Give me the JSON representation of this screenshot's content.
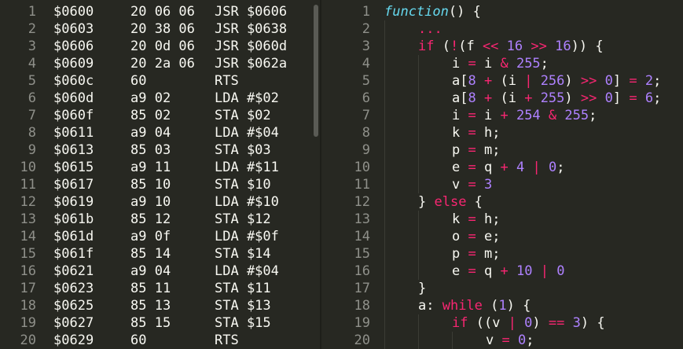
{
  "left_pane": {
    "lines": [
      {
        "n": "1",
        "addr": "$0600",
        "hex": "20 06 06",
        "ins": "JSR $0606"
      },
      {
        "n": "2",
        "addr": "$0603",
        "hex": "20 38 06",
        "ins": "JSR $0638"
      },
      {
        "n": "3",
        "addr": "$0606",
        "hex": "20 0d 06",
        "ins": "JSR $060d"
      },
      {
        "n": "4",
        "addr": "$0609",
        "hex": "20 2a 06",
        "ins": "JSR $062a"
      },
      {
        "n": "5",
        "addr": "$060c",
        "hex": "60",
        "ins": "RTS"
      },
      {
        "n": "6",
        "addr": "$060d",
        "hex": "a9 02",
        "ins": "LDA #$02"
      },
      {
        "n": "7",
        "addr": "$060f",
        "hex": "85 02",
        "ins": "STA $02"
      },
      {
        "n": "8",
        "addr": "$0611",
        "hex": "a9 04",
        "ins": "LDA #$04"
      },
      {
        "n": "9",
        "addr": "$0613",
        "hex": "85 03",
        "ins": "STA $03"
      },
      {
        "n": "10",
        "addr": "$0615",
        "hex": "a9 11",
        "ins": "LDA #$11"
      },
      {
        "n": "11",
        "addr": "$0617",
        "hex": "85 10",
        "ins": "STA $10"
      },
      {
        "n": "12",
        "addr": "$0619",
        "hex": "a9 10",
        "ins": "LDA #$10"
      },
      {
        "n": "13",
        "addr": "$061b",
        "hex": "85 12",
        "ins": "STA $12"
      },
      {
        "n": "14",
        "addr": "$061d",
        "hex": "a9 0f",
        "ins": "LDA #$0f"
      },
      {
        "n": "15",
        "addr": "$061f",
        "hex": "85 14",
        "ins": "STA $14"
      },
      {
        "n": "16",
        "addr": "$0621",
        "hex": "a9 04",
        "ins": "LDA #$04"
      },
      {
        "n": "17",
        "addr": "$0623",
        "hex": "85 11",
        "ins": "STA $11"
      },
      {
        "n": "18",
        "addr": "$0625",
        "hex": "85 13",
        "ins": "STA $13"
      },
      {
        "n": "19",
        "addr": "$0627",
        "hex": "85 15",
        "ins": "STA $15"
      },
      {
        "n": "20",
        "addr": "$0629",
        "hex": "60",
        "ins": "RTS"
      }
    ]
  },
  "right_pane": {
    "lines": [
      {
        "n": "1",
        "indent": 0,
        "tokens": [
          [
            "fn",
            "function"
          ],
          [
            "pl",
            "() {"
          ]
        ]
      },
      {
        "n": "2",
        "indent": 1,
        "tokens": [
          [
            "kw",
            "..."
          ]
        ]
      },
      {
        "n": "3",
        "indent": 1,
        "tokens": [
          [
            "kw",
            "if"
          ],
          [
            "pl",
            " ("
          ],
          [
            "op",
            "!"
          ],
          [
            "pl",
            "(f "
          ],
          [
            "op",
            "<<"
          ],
          [
            "pl",
            " "
          ],
          [
            "num",
            "16"
          ],
          [
            "pl",
            " "
          ],
          [
            "op",
            ">>"
          ],
          [
            "pl",
            " "
          ],
          [
            "num",
            "16"
          ],
          [
            "pl",
            ")) {"
          ]
        ]
      },
      {
        "n": "4",
        "indent": 2,
        "tokens": [
          [
            "pl",
            "i "
          ],
          [
            "op",
            "="
          ],
          [
            "pl",
            " i "
          ],
          [
            "op",
            "&"
          ],
          [
            "pl",
            " "
          ],
          [
            "num",
            "255"
          ],
          [
            "pl",
            ";"
          ]
        ]
      },
      {
        "n": "5",
        "indent": 2,
        "tokens": [
          [
            "pl",
            "a["
          ],
          [
            "num",
            "8"
          ],
          [
            "pl",
            " "
          ],
          [
            "op",
            "+"
          ],
          [
            "pl",
            " (i "
          ],
          [
            "op",
            "|"
          ],
          [
            "pl",
            " "
          ],
          [
            "num",
            "256"
          ],
          [
            "pl",
            ") "
          ],
          [
            "op",
            ">>"
          ],
          [
            "pl",
            " "
          ],
          [
            "num",
            "0"
          ],
          [
            "pl",
            "] "
          ],
          [
            "op",
            "="
          ],
          [
            "pl",
            " "
          ],
          [
            "num",
            "2"
          ],
          [
            "pl",
            ";"
          ]
        ]
      },
      {
        "n": "6",
        "indent": 2,
        "tokens": [
          [
            "pl",
            "a["
          ],
          [
            "num",
            "8"
          ],
          [
            "pl",
            " "
          ],
          [
            "op",
            "+"
          ],
          [
            "pl",
            " (i "
          ],
          [
            "op",
            "+"
          ],
          [
            "pl",
            " "
          ],
          [
            "num",
            "255"
          ],
          [
            "pl",
            ") "
          ],
          [
            "op",
            ">>"
          ],
          [
            "pl",
            " "
          ],
          [
            "num",
            "0"
          ],
          [
            "pl",
            "] "
          ],
          [
            "op",
            "="
          ],
          [
            "pl",
            " "
          ],
          [
            "num",
            "6"
          ],
          [
            "pl",
            ";"
          ]
        ]
      },
      {
        "n": "7",
        "indent": 2,
        "tokens": [
          [
            "pl",
            "i "
          ],
          [
            "op",
            "="
          ],
          [
            "pl",
            " i "
          ],
          [
            "op",
            "+"
          ],
          [
            "pl",
            " "
          ],
          [
            "num",
            "254"
          ],
          [
            "pl",
            " "
          ],
          [
            "op",
            "&"
          ],
          [
            "pl",
            " "
          ],
          [
            "num",
            "255"
          ],
          [
            "pl",
            ";"
          ]
        ]
      },
      {
        "n": "8",
        "indent": 2,
        "tokens": [
          [
            "pl",
            "k "
          ],
          [
            "op",
            "="
          ],
          [
            "pl",
            " h;"
          ]
        ]
      },
      {
        "n": "9",
        "indent": 2,
        "tokens": [
          [
            "pl",
            "p "
          ],
          [
            "op",
            "="
          ],
          [
            "pl",
            " m;"
          ]
        ]
      },
      {
        "n": "10",
        "indent": 2,
        "tokens": [
          [
            "pl",
            "e "
          ],
          [
            "op",
            "="
          ],
          [
            "pl",
            " q "
          ],
          [
            "op",
            "+"
          ],
          [
            "pl",
            " "
          ],
          [
            "num",
            "4"
          ],
          [
            "pl",
            " "
          ],
          [
            "op",
            "|"
          ],
          [
            "pl",
            " "
          ],
          [
            "num",
            "0"
          ],
          [
            "pl",
            ";"
          ]
        ]
      },
      {
        "n": "11",
        "indent": 2,
        "tokens": [
          [
            "pl",
            "v "
          ],
          [
            "op",
            "="
          ],
          [
            "pl",
            " "
          ],
          [
            "num",
            "3"
          ]
        ]
      },
      {
        "n": "12",
        "indent": 1,
        "tokens": [
          [
            "pl",
            "} "
          ],
          [
            "kw",
            "else"
          ],
          [
            "pl",
            " {"
          ]
        ]
      },
      {
        "n": "13",
        "indent": 2,
        "tokens": [
          [
            "pl",
            "k "
          ],
          [
            "op",
            "="
          ],
          [
            "pl",
            " h;"
          ]
        ]
      },
      {
        "n": "14",
        "indent": 2,
        "tokens": [
          [
            "pl",
            "o "
          ],
          [
            "op",
            "="
          ],
          [
            "pl",
            " e;"
          ]
        ]
      },
      {
        "n": "15",
        "indent": 2,
        "tokens": [
          [
            "pl",
            "p "
          ],
          [
            "op",
            "="
          ],
          [
            "pl",
            " m;"
          ]
        ]
      },
      {
        "n": "16",
        "indent": 2,
        "tokens": [
          [
            "pl",
            "e "
          ],
          [
            "op",
            "="
          ],
          [
            "pl",
            " q "
          ],
          [
            "op",
            "+"
          ],
          [
            "pl",
            " "
          ],
          [
            "num",
            "10"
          ],
          [
            "pl",
            " "
          ],
          [
            "op",
            "|"
          ],
          [
            "pl",
            " "
          ],
          [
            "num",
            "0"
          ]
        ]
      },
      {
        "n": "17",
        "indent": 1,
        "tokens": [
          [
            "pl",
            "}"
          ]
        ]
      },
      {
        "n": "18",
        "indent": 1,
        "tokens": [
          [
            "pl",
            "a: "
          ],
          [
            "kw",
            "while"
          ],
          [
            "pl",
            " ("
          ],
          [
            "num",
            "1"
          ],
          [
            "pl",
            ") {"
          ]
        ]
      },
      {
        "n": "19",
        "indent": 2,
        "tokens": [
          [
            "kw",
            "if"
          ],
          [
            "pl",
            " ((v "
          ],
          [
            "op",
            "|"
          ],
          [
            "pl",
            " "
          ],
          [
            "num",
            "0"
          ],
          [
            "pl",
            ") "
          ],
          [
            "op",
            "=="
          ],
          [
            "pl",
            " "
          ],
          [
            "num",
            "3"
          ],
          [
            "pl",
            ") {"
          ]
        ]
      },
      {
        "n": "20",
        "indent": 3,
        "tokens": [
          [
            "pl",
            "v "
          ],
          [
            "op",
            "="
          ],
          [
            "pl",
            " "
          ],
          [
            "num",
            "0"
          ],
          [
            "pl",
            ";"
          ]
        ]
      }
    ]
  },
  "colors": {
    "background": "#272822",
    "gutter": "#8f908a",
    "plain": "#f8f8f2",
    "keyword": "#f92672",
    "number": "#ae81ff",
    "function": "#66d9ef"
  }
}
